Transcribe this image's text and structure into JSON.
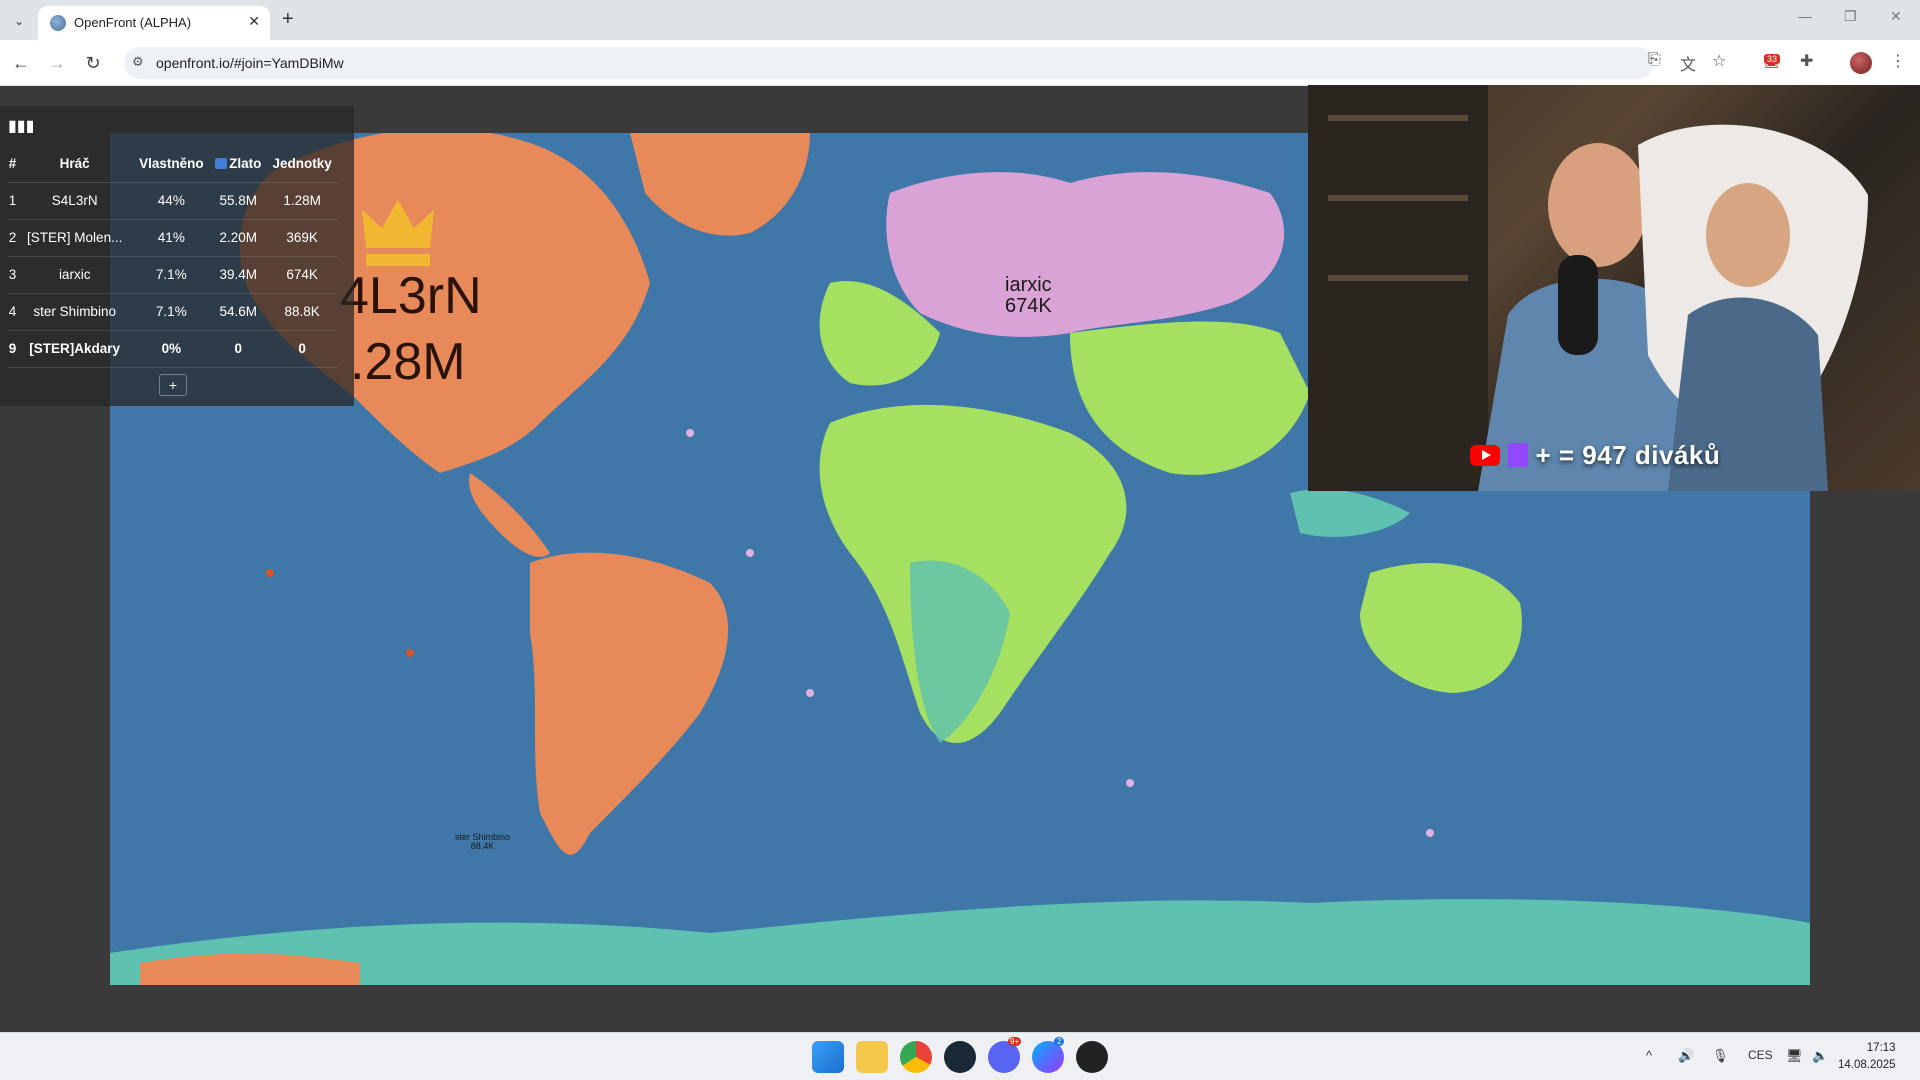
{
  "browser": {
    "tab_title": "OpenFront (ALPHA)",
    "url": "openfront.io/#join=YamDBiMw",
    "extension_badge": "33"
  },
  "leaderboard": {
    "headers": [
      "#",
      "Hráč",
      "Vlastněno",
      "Zlato",
      "Jednotky"
    ],
    "rows": [
      {
        "rank": "1",
        "player": "S4L3rN",
        "owned": "44%",
        "gold": "55.8M",
        "troops": "1.28M"
      },
      {
        "rank": "2",
        "player": "[STER] Molen...",
        "owned": "41%",
        "gold": "2.20M",
        "troops": "369K"
      },
      {
        "rank": "3",
        "player": "iarxic",
        "owned": "7.1%",
        "gold": "39.4M",
        "troops": "674K"
      },
      {
        "rank": "4",
        "player": "ster Shimbino",
        "owned": "7.1%",
        "gold": "54.6M",
        "troops": "88.8K"
      },
      {
        "rank": "9",
        "player": "[STER]Akdary",
        "owned": "0%",
        "gold": "0",
        "troops": "0"
      }
    ],
    "more_label": "+"
  },
  "map": {
    "leader_name": "4L3rN",
    "leader_troops": ".28M",
    "iarxic_name": "iarxic",
    "iarxic_troops": "674K",
    "shimbino_name": "ster Shimbino",
    "shimbino_troops": "88.4K"
  },
  "overlay": {
    "viewers_text": "+ = 947 diváků"
  },
  "taskbar": {
    "lang": "CES",
    "time": "17:13",
    "date": "14.08.2025",
    "discord_badge": "9+",
    "messenger_badge": "2"
  },
  "colors": {
    "ocean": "#3f77a8",
    "player_orange": "#e8895a",
    "player_pink": "#d9a3d6",
    "player_green": "#a6e060",
    "player_teal": "#5fc2b0"
  }
}
